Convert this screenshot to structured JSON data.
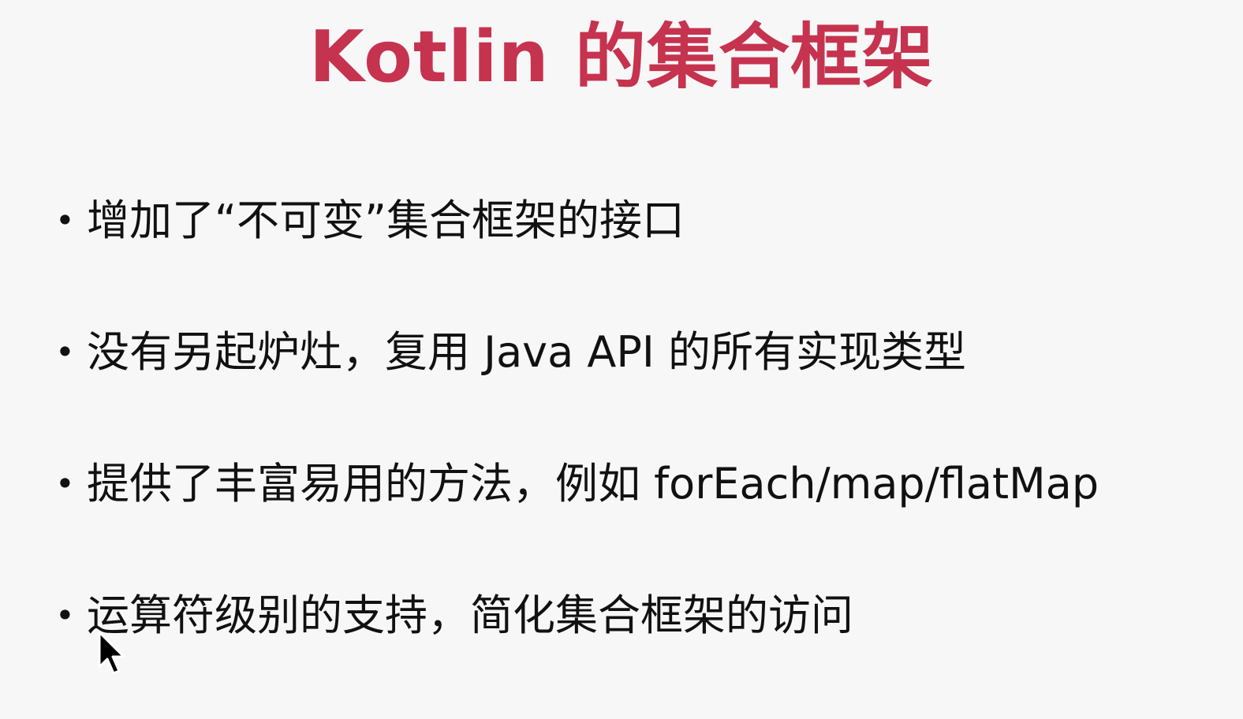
{
  "slide": {
    "title": "Kotlin 的集合框架",
    "bullet_glyph": "•",
    "bullets": [
      {
        "text": "增加了“不可变”集合框架的接口"
      },
      {
        "text": "没有另起炉灶，复用 Java API 的所有实现类型"
      },
      {
        "text": "提供了丰富易用的方法，例如 forEach/map/flatMap"
      },
      {
        "text": "运算符级别的支持，简化集合框架的访问"
      }
    ]
  },
  "colors": {
    "title": "#c6334f",
    "text": "#111111",
    "background": "#f7f7f7"
  },
  "icons": {
    "cursor": "mouse-pointer-icon"
  }
}
